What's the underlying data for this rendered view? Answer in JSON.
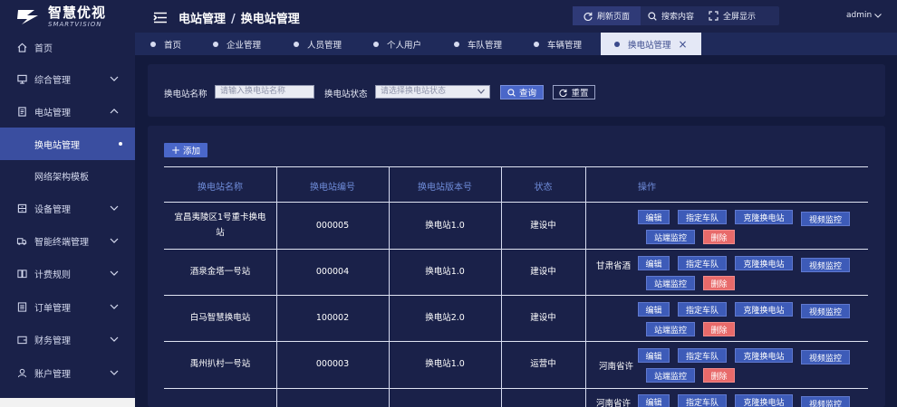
{
  "logo": {
    "name": "智慧优视",
    "sub": "SMARTVISION"
  },
  "menu": [
    {
      "label": "首页",
      "icon": "home-icon"
    },
    {
      "label": "综合管理",
      "icon": "monitor-icon"
    },
    {
      "label": "电站管理",
      "icon": "document-icon"
    },
    {
      "label": "换电站管理",
      "icon": ""
    },
    {
      "label": "网络架构模板",
      "icon": ""
    },
    {
      "label": "设备管理",
      "icon": "cabinet-icon"
    },
    {
      "label": "智能终端管理",
      "icon": "truck-icon"
    },
    {
      "label": "计费规则",
      "icon": "book-icon"
    },
    {
      "label": "订单管理",
      "icon": "list-icon"
    },
    {
      "label": "财务管理",
      "icon": "wallet-icon"
    },
    {
      "label": "账户管理",
      "icon": "user-icon"
    }
  ],
  "header": {
    "crumb_parent": "电站管理",
    "crumb_sep": "/",
    "crumb_current": "换电站管理",
    "refresh": "刷新页面",
    "search": "搜索内容",
    "fullscreen": "全屏显示",
    "user": "admin"
  },
  "tabs": [
    {
      "label": "首页"
    },
    {
      "label": "企业管理"
    },
    {
      "label": "人员管理"
    },
    {
      "label": "个人用户"
    },
    {
      "label": "车队管理"
    },
    {
      "label": "车辆管理"
    },
    {
      "label": "换电站管理"
    }
  ],
  "filter": {
    "name_label": "换电站名称",
    "name_placeholder": "请输入换电站名称",
    "status_label": "换电站状态",
    "status_placeholder": "请选择换电站状态",
    "query": "查询",
    "reset": "重置"
  },
  "add_label": "添加",
  "table": {
    "headers": [
      "换电站名称",
      "换电站编号",
      "换电站版本号",
      "状态",
      "操作"
    ],
    "rows": [
      {
        "name_line1": "宜昌夷陵区1号重卡换电",
        "name_line2": "站",
        "code": "000005",
        "version": "换电站1.0",
        "status": "建设中",
        "extra": ""
      },
      {
        "name_line1": "酒泉金塔一号站",
        "name_line2": "",
        "code": "000004",
        "version": "换电站1.0",
        "status": "建设中",
        "extra": "甘肃省酒"
      },
      {
        "name_line1": "白马智慧换电站",
        "name_line2": "",
        "code": "100002",
        "version": "换电站2.0",
        "status": "建设中",
        "extra": ""
      },
      {
        "name_line1": "禹州扒村一号站",
        "name_line2": "",
        "code": "000003",
        "version": "换电站1.0",
        "status": "运营中",
        "extra": "河南省许"
      }
    ],
    "partial_extra": "河南省许",
    "ops": {
      "edit": "编辑",
      "assign": "指定车队",
      "clone": "克隆换电站",
      "video": "视频监控",
      "station": "站端监控",
      "delete": "删除"
    }
  }
}
